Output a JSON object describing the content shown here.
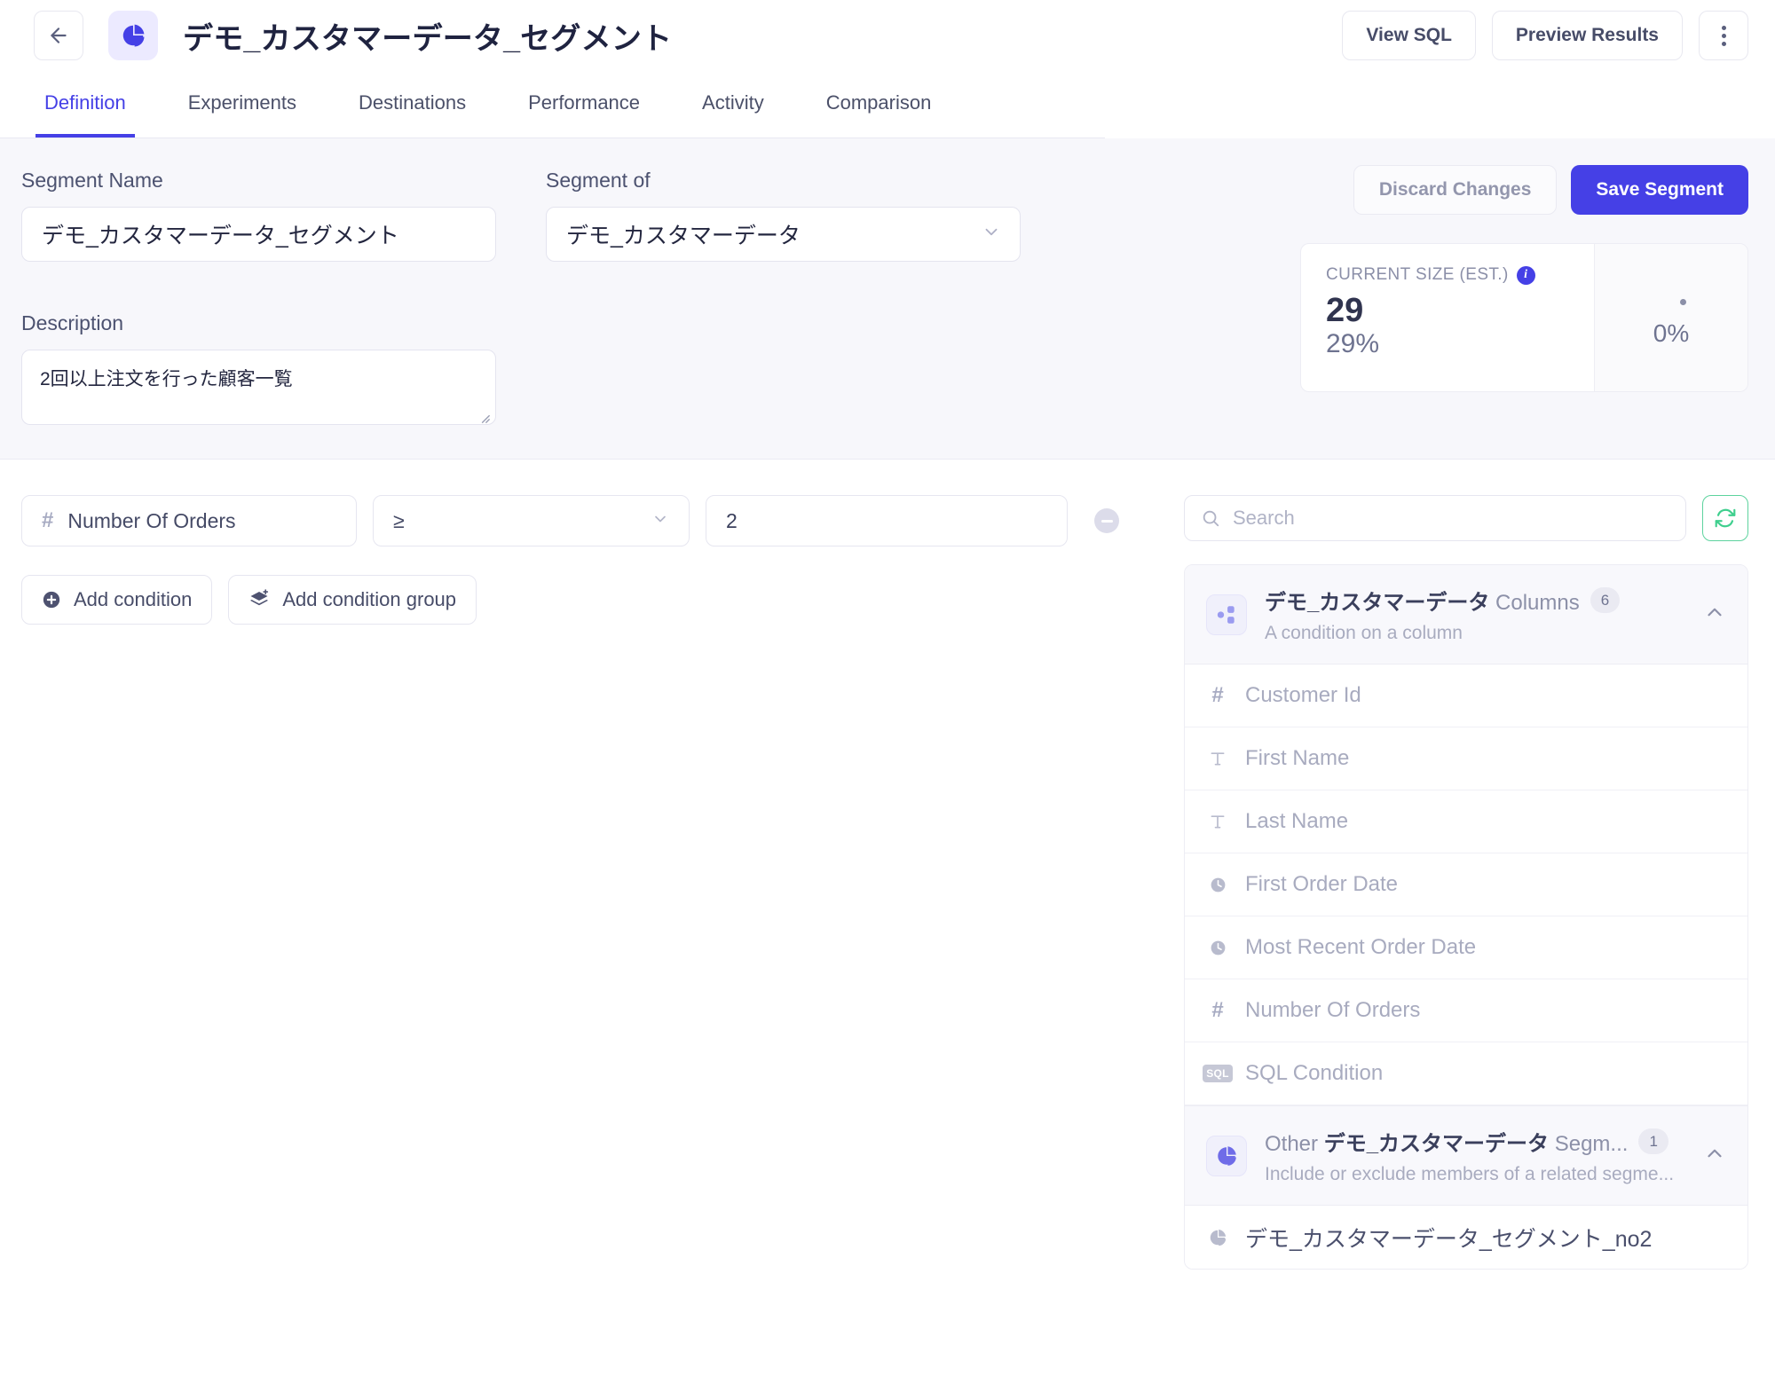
{
  "header": {
    "back_label": "←",
    "icon": "pie-chart-icon",
    "title": "デモ_カスタマーデータ_セグメント",
    "view_sql_label": "View SQL",
    "preview_results_label": "Preview Results",
    "more_label": "⋮"
  },
  "tabs": [
    {
      "label": "Definition",
      "active": true
    },
    {
      "label": "Experiments",
      "active": false
    },
    {
      "label": "Destinations",
      "active": false
    },
    {
      "label": "Performance",
      "active": false
    },
    {
      "label": "Activity",
      "active": false
    },
    {
      "label": "Comparison",
      "active": false
    }
  ],
  "form": {
    "segment_name_label": "Segment Name",
    "segment_name_value": "デモ_カスタマーデータ_セグメント",
    "segment_of_label": "Segment of",
    "segment_of_value": "デモ_カスタマーデータ",
    "description_label": "Description",
    "description_value": "2回以上注文を行った顧客一覧"
  },
  "actions": {
    "discard_label": "Discard Changes",
    "save_label": "Save Segment",
    "accent_color": "#4540e6"
  },
  "size_card": {
    "caption": "CURRENT SIZE (EST.)",
    "info_glyph": "i",
    "value": "29",
    "percent": "29%",
    "right_percent": "0%"
  },
  "condition": {
    "attribute": "Number Of Orders",
    "attribute_type_glyph": "#",
    "operator": "≥",
    "value": "2",
    "remove_label": "−"
  },
  "builder_buttons": {
    "add_condition_label": "Add condition",
    "add_condition_group_label": "Add condition group"
  },
  "search": {
    "placeholder": "Search",
    "value": "",
    "refresh_title": "Refresh"
  },
  "groups": [
    {
      "title_bold": "デモ_カスタマーデータ",
      "title_rest": " Columns",
      "count": "6",
      "subtitle": "A condition on a column",
      "icon": "nodes-icon",
      "caret": "chevron-up-icon",
      "items": [
        {
          "label": "Customer Id",
          "type": "number"
        },
        {
          "label": "First Name",
          "type": "text"
        },
        {
          "label": "Last Name",
          "type": "text"
        },
        {
          "label": "First Order Date",
          "type": "date"
        },
        {
          "label": "Most Recent Order Date",
          "type": "date"
        },
        {
          "label": "Number Of Orders",
          "type": "number"
        },
        {
          "label": "SQL Condition",
          "type": "sql"
        }
      ]
    },
    {
      "title_prefix": "Other ",
      "title_bold": "デモ_カスタマーデータ",
      "title_rest": " Segm...",
      "count": "1",
      "subtitle": "Include or exclude members of a related segme...",
      "icon": "pie-chart-icon",
      "caret": "chevron-up-icon",
      "items": [
        {
          "label": "デモ_カスタマーデータ_セグメント_no2",
          "type": "segment"
        }
      ]
    }
  ]
}
